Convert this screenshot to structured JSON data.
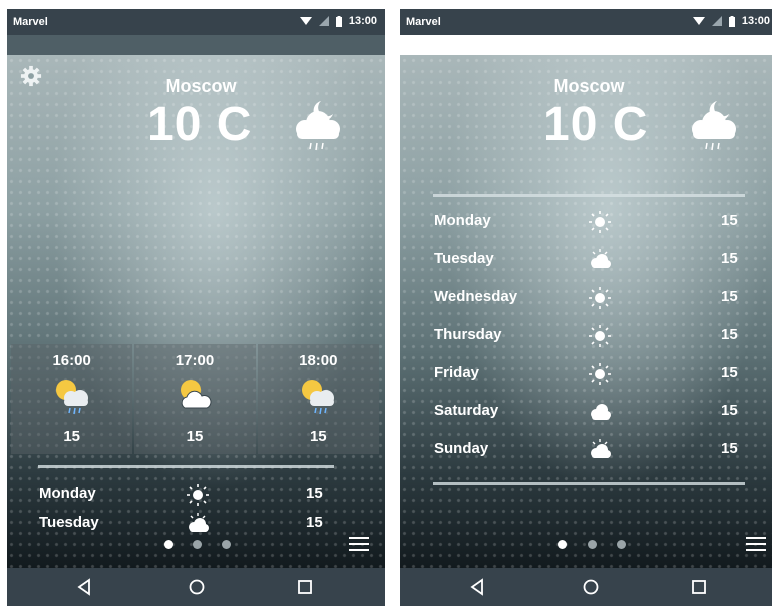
{
  "colors": {
    "status_bar": "#37434c",
    "nav_bar": "#37434c",
    "text": "#ffffff",
    "sun_yellow": "#f5c842",
    "rain_blue": "#6fb6ff",
    "dot_active": "#ffffff",
    "dot_inactive": "#9aa4a8"
  },
  "screens": [
    {
      "status_bar": {
        "carrier": "Marvel",
        "time": "13:00",
        "icons": [
          "wifi-icon",
          "signal-icon",
          "battery-icon"
        ]
      },
      "header": {
        "settings_icon": "gear-icon",
        "city": "Moscow",
        "temperature": "10 C",
        "condition_icon": "cloud-moon-rain-icon"
      },
      "hourly": [
        {
          "time": "16:00",
          "temp": "15",
          "icon": "sun-cloud-rain-icon"
        },
        {
          "time": "17:00",
          "temp": "15",
          "icon": "sun-cloud-icon"
        },
        {
          "time": "18:00",
          "temp": "15",
          "icon": "sun-cloud-rain-icon"
        }
      ],
      "daily": [
        {
          "day": "Monday",
          "temp": "15",
          "icon": "sun-icon"
        },
        {
          "day": "Tuesday",
          "temp": "15",
          "icon": "sun-cloud-icon"
        }
      ],
      "pager": {
        "total": 3,
        "active": 0
      },
      "menu_icon": "hamburger-menu-icon",
      "nav_bar": [
        "back-icon",
        "home-icon",
        "recents-icon"
      ]
    },
    {
      "status_bar": {
        "carrier": "Marvel",
        "time": "13:00",
        "icons": [
          "wifi-icon",
          "signal-icon",
          "battery-icon"
        ]
      },
      "header": {
        "city": "Moscow",
        "temperature": "10 C",
        "condition_icon": "cloud-moon-rain-icon"
      },
      "daily": [
        {
          "day": "Monday",
          "temp": "15",
          "icon": "sun-icon"
        },
        {
          "day": "Tuesday",
          "temp": "15",
          "icon": "cloud-sun-icon"
        },
        {
          "day": "Wednesday",
          "temp": "15",
          "icon": "sun-icon"
        },
        {
          "day": "Thursday",
          "temp": "15",
          "icon": "sun-icon"
        },
        {
          "day": "Friday",
          "temp": "15",
          "icon": "sun-icon"
        },
        {
          "day": "Saturday",
          "temp": "15",
          "icon": "cloud-icon"
        },
        {
          "day": "Sunday",
          "temp": "15",
          "icon": "cloud-sun-icon"
        }
      ],
      "pager": {
        "total": 3,
        "active": 0
      },
      "menu_icon": "hamburger-menu-icon",
      "nav_bar": [
        "back-icon",
        "home-icon",
        "recents-icon"
      ]
    }
  ]
}
